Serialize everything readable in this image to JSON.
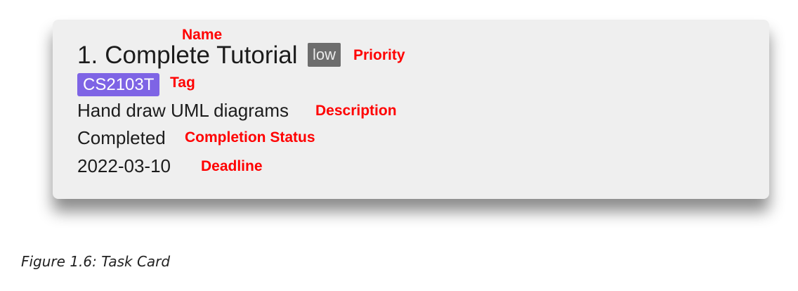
{
  "card": {
    "index": "1.",
    "name": "Complete Tutorial",
    "priority": "low",
    "tag": "CS2103T",
    "description": "Hand draw UML diagrams",
    "status": "Completed",
    "deadline": "2022-03-10"
  },
  "annotations": {
    "name": "Name",
    "priority": "Priority",
    "tag": "Tag",
    "description": "Description",
    "status": "Completion Status",
    "deadline": "Deadline"
  },
  "caption": "Figure 1.6: Task Card",
  "colors": {
    "annotation": "#ff0000",
    "tag_badge": "#7e64e5",
    "priority_badge": "#6d6d6d",
    "card_background": "#efefef"
  }
}
